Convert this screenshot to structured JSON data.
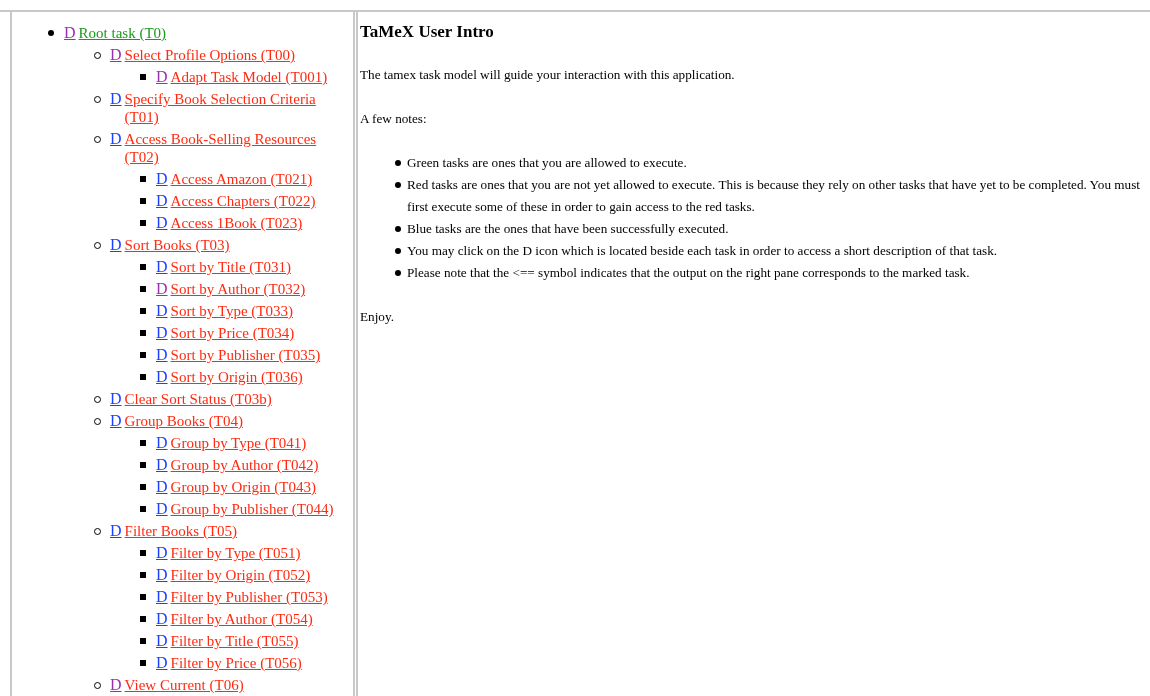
{
  "task_tree": [
    {
      "icon": "D",
      "icon_visited": true,
      "label": "Root task (T0)",
      "color": "#1a9a1a",
      "children": [
        {
          "icon": "D",
          "icon_visited": true,
          "label": "Select Profile Options (T00)",
          "color": "#ff2a10",
          "children": [
            {
              "icon": "D",
              "icon_visited": true,
              "label": "Adapt Task Model (T001)",
              "color": "#ff2a10"
            }
          ]
        },
        {
          "icon": "D",
          "icon_visited": false,
          "label": "Specify Book Selection Criteria (T01)",
          "color": "#ff2a10"
        },
        {
          "icon": "D",
          "icon_visited": false,
          "label": "Access Book-Selling Resources (T02)",
          "color": "#ff2a10",
          "children": [
            {
              "icon": "D",
              "icon_visited": false,
              "label": "Access Amazon (T021)",
              "color": "#ff2a10"
            },
            {
              "icon": "D",
              "icon_visited": false,
              "label": "Access Chapters (T022)",
              "color": "#ff2a10"
            },
            {
              "icon": "D",
              "icon_visited": false,
              "label": "Access 1Book (T023)",
              "color": "#ff2a10"
            }
          ]
        },
        {
          "icon": "D",
          "icon_visited": false,
          "label": "Sort Books (T03)",
          "color": "#ff2a10",
          "children": [
            {
              "icon": "D",
              "icon_visited": false,
              "label": "Sort by Title (T031)",
              "color": "#ff2a10"
            },
            {
              "icon": "D",
              "icon_visited": true,
              "label": "Sort by Author (T032)",
              "color": "#ff2a10"
            },
            {
              "icon": "D",
              "icon_visited": false,
              "label": "Sort by Type (T033)",
              "color": "#ff2a10"
            },
            {
              "icon": "D",
              "icon_visited": false,
              "label": "Sort by Price (T034)",
              "color": "#ff2a10"
            },
            {
              "icon": "D",
              "icon_visited": false,
              "label": "Sort by Publisher (T035)",
              "color": "#ff2a10"
            },
            {
              "icon": "D",
              "icon_visited": false,
              "label": "Sort by Origin (T036)",
              "color": "#ff2a10"
            }
          ]
        },
        {
          "icon": "D",
          "icon_visited": false,
          "label": "Clear Sort Status (T03b)",
          "color": "#ff2a10"
        },
        {
          "icon": "D",
          "icon_visited": false,
          "label": "Group Books (T04)",
          "color": "#ff2a10",
          "children": [
            {
              "icon": "D",
              "icon_visited": false,
              "label": "Group by Type (T041)",
              "color": "#ff2a10"
            },
            {
              "icon": "D",
              "icon_visited": false,
              "label": "Group by Author (T042)",
              "color": "#ff2a10"
            },
            {
              "icon": "D",
              "icon_visited": false,
              "label": "Group by Origin (T043)",
              "color": "#ff2a10"
            },
            {
              "icon": "D",
              "icon_visited": false,
              "label": "Group by Publisher (T044)",
              "color": "#ff2a10"
            }
          ]
        },
        {
          "icon": "D",
          "icon_visited": false,
          "label": "Filter Books (T05)",
          "color": "#ff2a10",
          "children": [
            {
              "icon": "D",
              "icon_visited": false,
              "label": "Filter by Type (T051)",
              "color": "#ff2a10"
            },
            {
              "icon": "D",
              "icon_visited": false,
              "label": "Filter by Origin (T052)",
              "color": "#ff2a10"
            },
            {
              "icon": "D",
              "icon_visited": false,
              "label": "Filter by Publisher (T053)",
              "color": "#ff2a10"
            },
            {
              "icon": "D",
              "icon_visited": false,
              "label": "Filter by Author (T054)",
              "color": "#ff2a10"
            },
            {
              "icon": "D",
              "icon_visited": false,
              "label": "Filter by Title (T055)",
              "color": "#ff2a10"
            },
            {
              "icon": "D",
              "icon_visited": false,
              "label": "Filter by Price (T056)",
              "color": "#ff2a10"
            }
          ]
        },
        {
          "icon": "D",
          "icon_visited": true,
          "label": "View Current (T06)",
          "color": "#ff2a10"
        }
      ]
    }
  ],
  "intro": {
    "title": "TaMeX User Intro",
    "paragraphs": [
      "The tamex task model will guide your interaction with this application.",
      "A few notes:"
    ],
    "notes": [
      "Green tasks are ones that you are allowed to execute.",
      "Red tasks are ones that you are not yet allowed to execute. This is because they rely on other tasks that have yet to be completed. You must first execute some of these in order to gain access to the red tasks.",
      "Blue tasks are the ones that have been successfully executed.",
      "You may click on the D icon which is located beside each task in order to access a short description of that task.",
      "Please note that the <== symbol indicates that the output on the right pane corresponds to the marked task."
    ],
    "closing": "Enjoy."
  }
}
